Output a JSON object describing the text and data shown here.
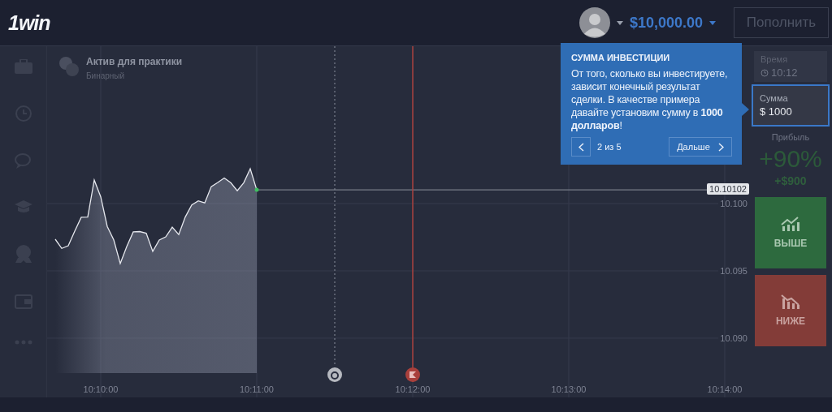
{
  "header": {
    "logo": "1win",
    "balance": "$10,000.00",
    "deposit_button": "Пополнить"
  },
  "asset": {
    "name": "Актив для практики",
    "type": "Бинарный"
  },
  "chart": {
    "current_price": "10.10102",
    "chart_data": {
      "type": "area",
      "categories": [
        null,
        null,
        null,
        null,
        null,
        null,
        null,
        "10:10:00",
        null,
        null,
        null,
        null,
        null,
        null,
        null,
        null,
        null,
        null,
        null,
        null,
        null,
        null,
        null,
        null,
        null,
        null,
        null,
        null,
        null,
        null,
        null,
        "10:11:00",
        null,
        null,
        null,
        null,
        null,
        null,
        null,
        null,
        null,
        null,
        null,
        null,
        null,
        null,
        null,
        null,
        null,
        null,
        null,
        null,
        null,
        null,
        null,
        "10:12:00",
        null,
        null,
        null,
        null,
        null,
        null,
        null,
        null,
        null,
        null,
        null,
        null,
        null,
        null,
        null,
        null,
        null,
        null,
        null,
        null,
        null,
        null,
        null,
        "10:13:00",
        null,
        null,
        null,
        null,
        null,
        null,
        null,
        null,
        null,
        null,
        null,
        null,
        null,
        null,
        null,
        null,
        null,
        null,
        null,
        null,
        null,
        null,
        null,
        "10:14:00"
      ],
      "series": [
        {
          "color": "#e6e8ee",
          "values": [
            10.09735,
            10.09667,
            10.09687,
            10.09795,
            10.09898,
            10.099,
            10.10175,
            10.1005,
            10.0983,
            10.0973,
            10.09554,
            10.0968,
            10.0979,
            10.09792,
            10.0978,
            10.09645,
            10.09729,
            10.09753,
            10.09825,
            10.0977,
            10.099,
            10.0999,
            10.1002,
            10.10005,
            10.10126,
            10.10157,
            10.1019,
            10.10155,
            10.10096,
            10.10155,
            10.10259,
            10.10102,
            null,
            null,
            null,
            null,
            null,
            null,
            null,
            null,
            null,
            null,
            null,
            null,
            null,
            null,
            null,
            null,
            null,
            null,
            null,
            null,
            null,
            null,
            null,
            null,
            null,
            null,
            null,
            null,
            null,
            null,
            null,
            null,
            null,
            null,
            null,
            null,
            null,
            null,
            null,
            null,
            null,
            null,
            null,
            null,
            null,
            null,
            null,
            null,
            null,
            null,
            null,
            null,
            null,
            null,
            null,
            null,
            null,
            null,
            null,
            null,
            null,
            null,
            null,
            null,
            null,
            null,
            null,
            null,
            null,
            null,
            null,
            null
          ]
        }
      ],
      "grid": true,
      "ylim": [
        10.0856,
        10.11169
      ],
      "yticks": [
        {
          "value": 10.09,
          "label": "10.090"
        },
        {
          "value": 10.095,
          "label": "10.095"
        },
        {
          "value": 10.1,
          "label": "10.100"
        }
      ]
    },
    "markers": [
      {
        "kind": "timer"
      },
      {
        "kind": "expiration"
      }
    ]
  },
  "tooltip": {
    "title": "СУММА ИНВЕСТИЦИИ",
    "text": "От того, сколько вы инвестируете, зависит конечный результат сделки. В качестве примера давайте установим сумму в **1000 долларов**!",
    "step": "2 из 5",
    "next_button": "Дальше"
  },
  "trade_panel": {
    "time_label": "Время",
    "time_value": "10:12",
    "amount_label": "Сумма",
    "amount_value": "$ 1000",
    "amount_highlighted": true,
    "profit_label": "Прибыль",
    "profit_percent": "+90%",
    "profit_amount": "+$900",
    "buttons": [
      {
        "kind": "up",
        "label": "ВЫШЕ"
      },
      {
        "kind": "down",
        "label": "НИЖЕ"
      }
    ]
  }
}
